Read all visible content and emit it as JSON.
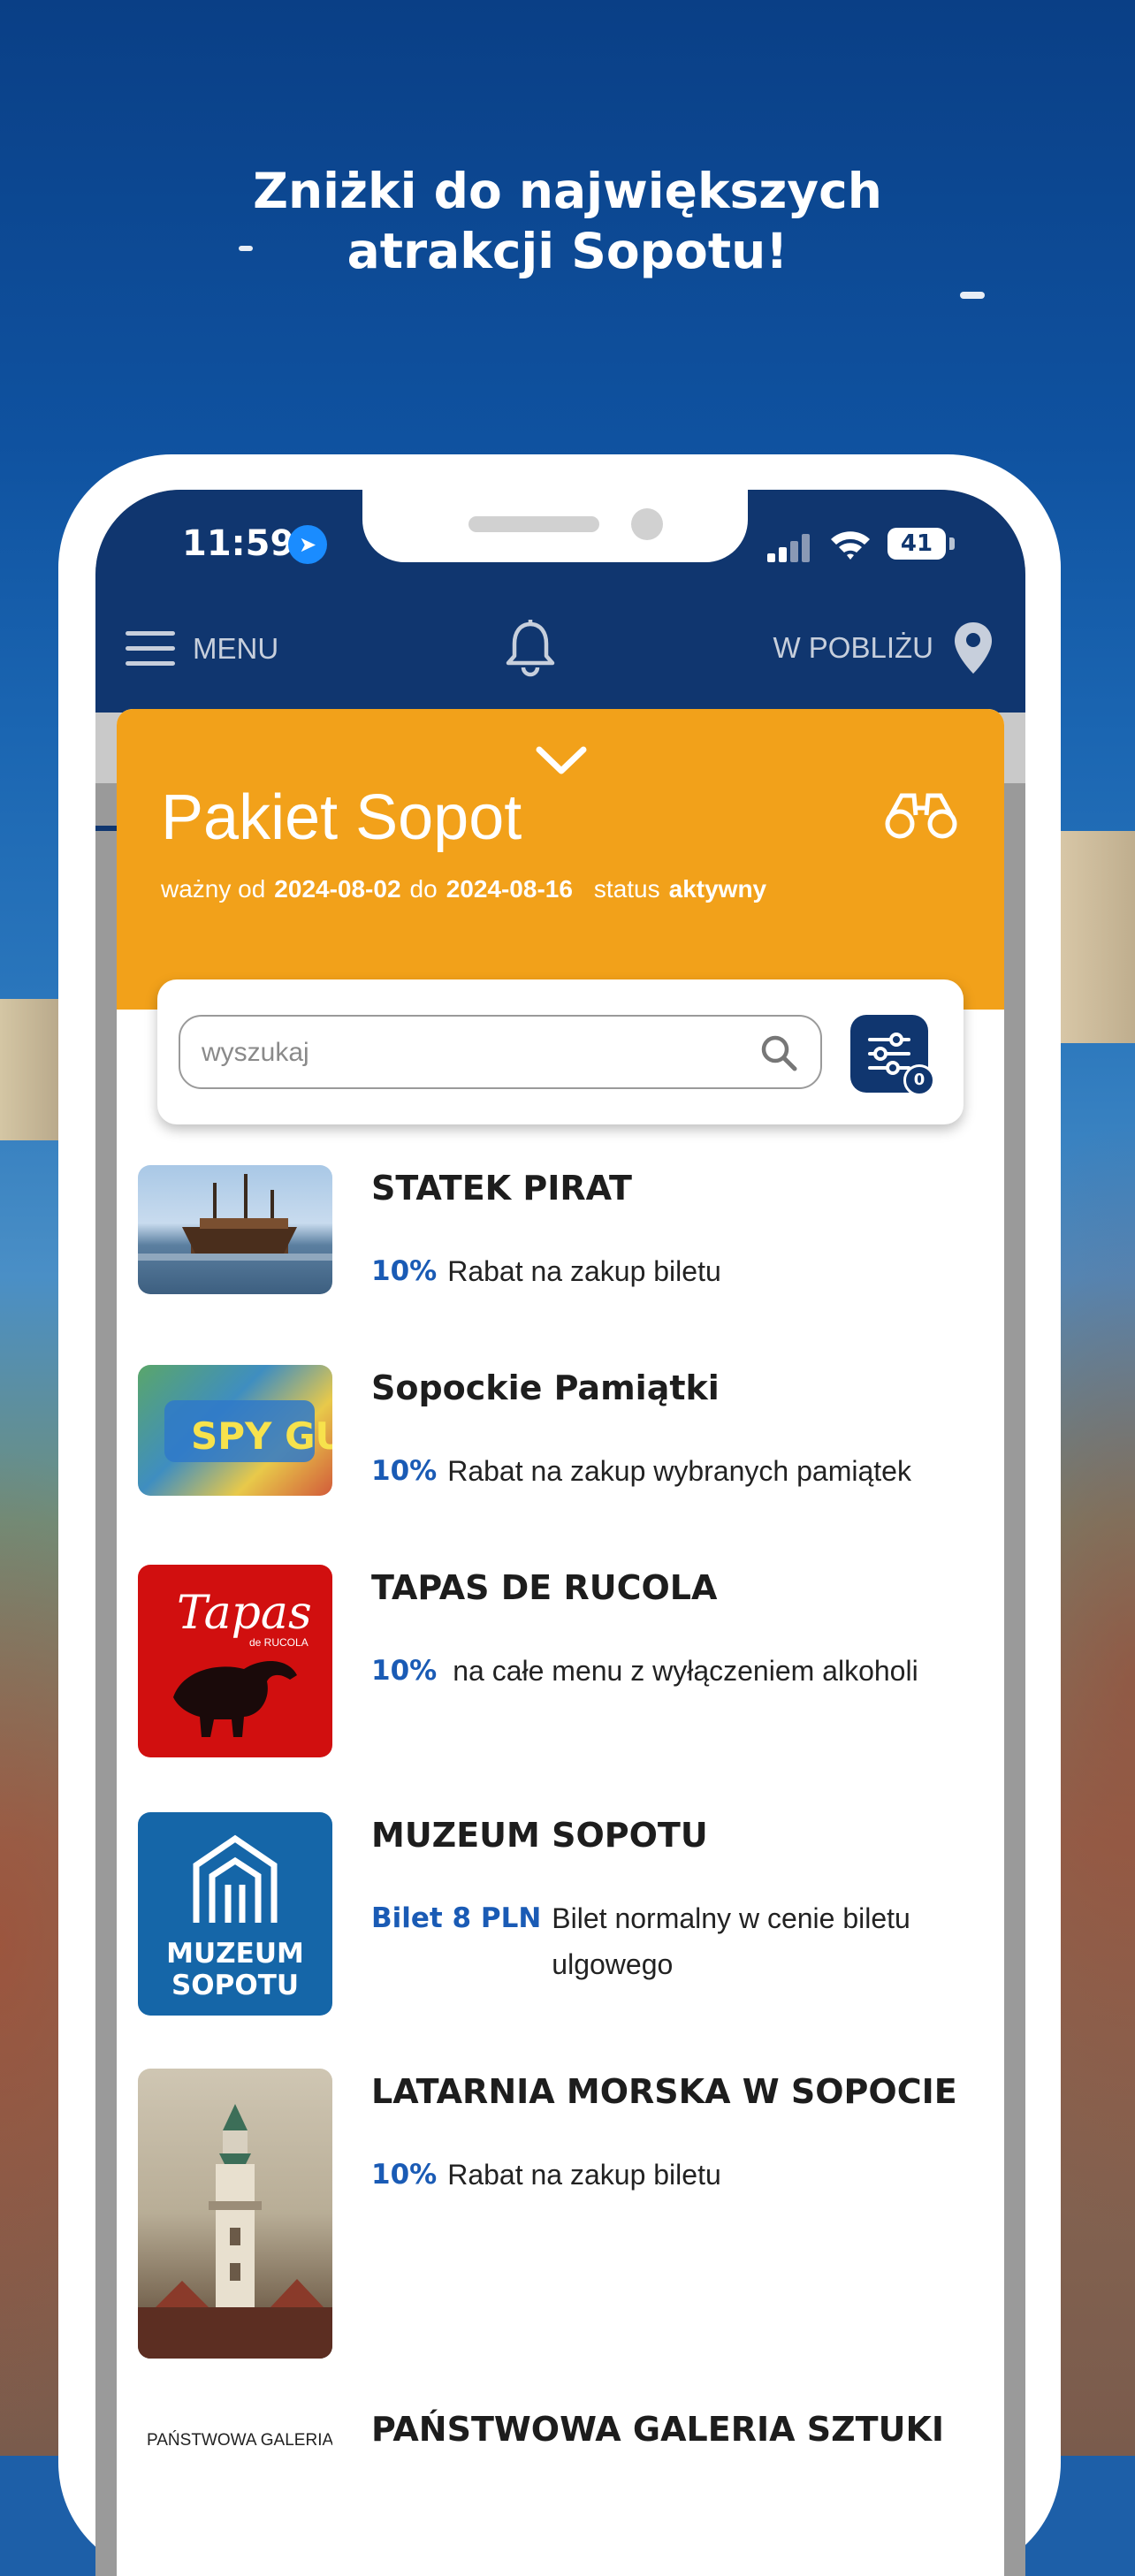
{
  "headline": {
    "line1": "Zniżki do największych",
    "line2": "atrakcji Sopotu!"
  },
  "status_bar": {
    "time": "11:59",
    "battery": "41"
  },
  "app_bar": {
    "menu_label": "MENU",
    "nearby_label": "W POBLIŻU"
  },
  "package": {
    "title": "Pakiet Sopot",
    "valid_from_label": "ważny od",
    "valid_from": "2024-08-02",
    "valid_to_label": "do",
    "valid_to": "2024-08-16",
    "status_label": "status",
    "status": "aktywny"
  },
  "search": {
    "placeholder": "wyszukaj",
    "filter_count": "0"
  },
  "items": [
    {
      "title": "STATEK PIRAT",
      "discount": "10%",
      "desc": "Rabat  na zakup biletu"
    },
    {
      "title": "Sopockie Pamiątki",
      "discount": "10%",
      "desc": "Rabat  na zakup wybranych pamiątek"
    },
    {
      "title": "TAPAS DE RUCOLA",
      "discount": "10%",
      "desc": "na całe menu z wyłączeniem alkoholi"
    },
    {
      "title": "MUZEUM SOPOTU",
      "discount": "Bilet 8 PLN",
      "desc": "Bilet normalny w cenie biletu ulgowego"
    },
    {
      "title": "LATARNIA MORSKA W SOPOCIE",
      "discount": "10%",
      "desc": "Rabat  na zakup biletu"
    },
    {
      "title": "PAŃSTWOWA GALERIA SZTUKI",
      "discount": "",
      "desc": ""
    }
  ],
  "logos": {
    "tapas_text": "Tapas",
    "tapas_sub": "de RUCOLA",
    "muzeum_line1": "MUZEUM",
    "muzeum_line2": "SOPOTU",
    "galeria_text": "PAŃSTWOWA GALERIA SZTUKI",
    "spy_text": "SPY GUY"
  },
  "colors": {
    "navy": "#10366f",
    "orange": "#f2a11a",
    "discount_blue": "#1a5bb5"
  }
}
